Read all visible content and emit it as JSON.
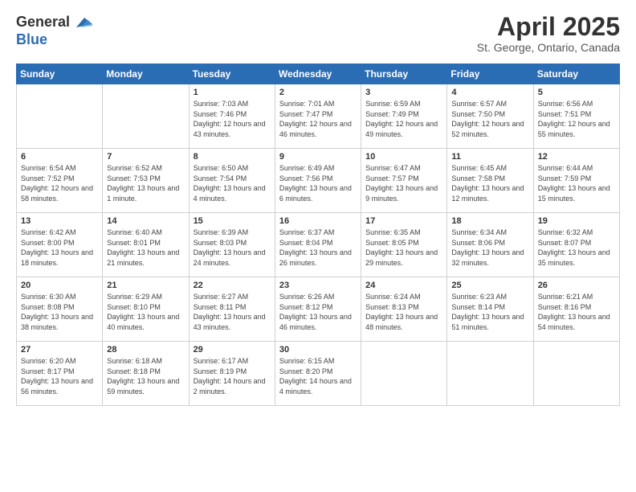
{
  "logo": {
    "general": "General",
    "blue": "Blue"
  },
  "title": "April 2025",
  "subtitle": "St. George, Ontario, Canada",
  "days_header": [
    "Sunday",
    "Monday",
    "Tuesday",
    "Wednesday",
    "Thursday",
    "Friday",
    "Saturday"
  ],
  "weeks": [
    [
      {
        "day": "",
        "info": ""
      },
      {
        "day": "",
        "info": ""
      },
      {
        "day": "1",
        "info": "Sunrise: 7:03 AM\nSunset: 7:46 PM\nDaylight: 12 hours and 43 minutes."
      },
      {
        "day": "2",
        "info": "Sunrise: 7:01 AM\nSunset: 7:47 PM\nDaylight: 12 hours and 46 minutes."
      },
      {
        "day": "3",
        "info": "Sunrise: 6:59 AM\nSunset: 7:49 PM\nDaylight: 12 hours and 49 minutes."
      },
      {
        "day": "4",
        "info": "Sunrise: 6:57 AM\nSunset: 7:50 PM\nDaylight: 12 hours and 52 minutes."
      },
      {
        "day": "5",
        "info": "Sunrise: 6:56 AM\nSunset: 7:51 PM\nDaylight: 12 hours and 55 minutes."
      }
    ],
    [
      {
        "day": "6",
        "info": "Sunrise: 6:54 AM\nSunset: 7:52 PM\nDaylight: 12 hours and 58 minutes."
      },
      {
        "day": "7",
        "info": "Sunrise: 6:52 AM\nSunset: 7:53 PM\nDaylight: 13 hours and 1 minute."
      },
      {
        "day": "8",
        "info": "Sunrise: 6:50 AM\nSunset: 7:54 PM\nDaylight: 13 hours and 4 minutes."
      },
      {
        "day": "9",
        "info": "Sunrise: 6:49 AM\nSunset: 7:56 PM\nDaylight: 13 hours and 6 minutes."
      },
      {
        "day": "10",
        "info": "Sunrise: 6:47 AM\nSunset: 7:57 PM\nDaylight: 13 hours and 9 minutes."
      },
      {
        "day": "11",
        "info": "Sunrise: 6:45 AM\nSunset: 7:58 PM\nDaylight: 13 hours and 12 minutes."
      },
      {
        "day": "12",
        "info": "Sunrise: 6:44 AM\nSunset: 7:59 PM\nDaylight: 13 hours and 15 minutes."
      }
    ],
    [
      {
        "day": "13",
        "info": "Sunrise: 6:42 AM\nSunset: 8:00 PM\nDaylight: 13 hours and 18 minutes."
      },
      {
        "day": "14",
        "info": "Sunrise: 6:40 AM\nSunset: 8:01 PM\nDaylight: 13 hours and 21 minutes."
      },
      {
        "day": "15",
        "info": "Sunrise: 6:39 AM\nSunset: 8:03 PM\nDaylight: 13 hours and 24 minutes."
      },
      {
        "day": "16",
        "info": "Sunrise: 6:37 AM\nSunset: 8:04 PM\nDaylight: 13 hours and 26 minutes."
      },
      {
        "day": "17",
        "info": "Sunrise: 6:35 AM\nSunset: 8:05 PM\nDaylight: 13 hours and 29 minutes."
      },
      {
        "day": "18",
        "info": "Sunrise: 6:34 AM\nSunset: 8:06 PM\nDaylight: 13 hours and 32 minutes."
      },
      {
        "day": "19",
        "info": "Sunrise: 6:32 AM\nSunset: 8:07 PM\nDaylight: 13 hours and 35 minutes."
      }
    ],
    [
      {
        "day": "20",
        "info": "Sunrise: 6:30 AM\nSunset: 8:08 PM\nDaylight: 13 hours and 38 minutes."
      },
      {
        "day": "21",
        "info": "Sunrise: 6:29 AM\nSunset: 8:10 PM\nDaylight: 13 hours and 40 minutes."
      },
      {
        "day": "22",
        "info": "Sunrise: 6:27 AM\nSunset: 8:11 PM\nDaylight: 13 hours and 43 minutes."
      },
      {
        "day": "23",
        "info": "Sunrise: 6:26 AM\nSunset: 8:12 PM\nDaylight: 13 hours and 46 minutes."
      },
      {
        "day": "24",
        "info": "Sunrise: 6:24 AM\nSunset: 8:13 PM\nDaylight: 13 hours and 48 minutes."
      },
      {
        "day": "25",
        "info": "Sunrise: 6:23 AM\nSunset: 8:14 PM\nDaylight: 13 hours and 51 minutes."
      },
      {
        "day": "26",
        "info": "Sunrise: 6:21 AM\nSunset: 8:16 PM\nDaylight: 13 hours and 54 minutes."
      }
    ],
    [
      {
        "day": "27",
        "info": "Sunrise: 6:20 AM\nSunset: 8:17 PM\nDaylight: 13 hours and 56 minutes."
      },
      {
        "day": "28",
        "info": "Sunrise: 6:18 AM\nSunset: 8:18 PM\nDaylight: 13 hours and 59 minutes."
      },
      {
        "day": "29",
        "info": "Sunrise: 6:17 AM\nSunset: 8:19 PM\nDaylight: 14 hours and 2 minutes."
      },
      {
        "day": "30",
        "info": "Sunrise: 6:15 AM\nSunset: 8:20 PM\nDaylight: 14 hours and 4 minutes."
      },
      {
        "day": "",
        "info": ""
      },
      {
        "day": "",
        "info": ""
      },
      {
        "day": "",
        "info": ""
      }
    ]
  ]
}
